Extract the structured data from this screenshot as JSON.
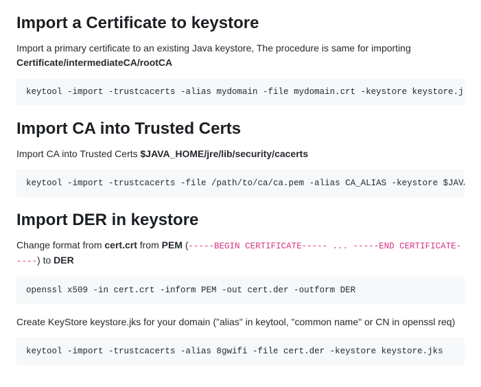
{
  "sections": [
    {
      "heading": "Import a Certificate to keystore",
      "intro_prefix": "Import a primary certificate to an existing Java keystore, The procedure is same for importing ",
      "intro_bold": "Certificate/intermediateCA/rootCA",
      "intro_suffix": "",
      "code": "keytool -import -trustcacerts -alias mydomain -file mydomain.crt -keystore keystore.jks"
    },
    {
      "heading": "Import CA into Trusted Certs",
      "intro_prefix": "Import CA into Trusted Certs ",
      "intro_bold": "$JAVA_HOME/jre/lib/security/cacerts",
      "intro_suffix": "",
      "code": "keytool -import -trustcacerts -file /path/to/ca/ca.pem -alias CA_ALIAS -keystore $JAVA"
    }
  ],
  "der": {
    "heading": "Import DER in keystore",
    "p1_a": "Change format from ",
    "p1_bold1": "cert.crt",
    "p1_b": " from ",
    "p1_bold2": "PEM",
    "p1_c": " (",
    "p1_inline": "-----BEGIN CERTIFICATE----- ... -----END CERTIFICATE-----",
    "p1_d": ") to ",
    "p1_bold3": "DER",
    "code1": "openssl x509 -in cert.crt -inform PEM -out cert.der -outform DER",
    "p2": "Create KeyStore keystore.jks for your domain (\"alias\" in keytool, \"common name\" or CN in openssl req)",
    "code2": "keytool -import -trustcacerts -alias 8gwifi -file cert.der -keystore keystore.jks"
  }
}
